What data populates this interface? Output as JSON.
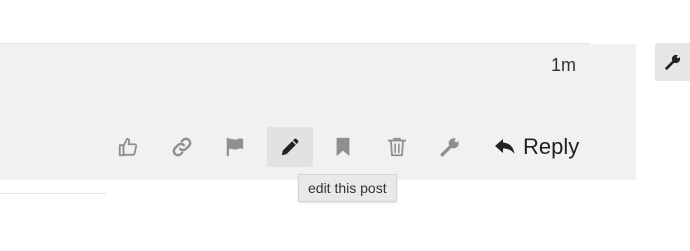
{
  "post": {
    "age": "1m",
    "actions": {
      "like": {
        "icon": "thumbs-up-icon"
      },
      "link": {
        "icon": "link-icon"
      },
      "flag": {
        "icon": "flag-icon"
      },
      "edit": {
        "icon": "pencil-icon",
        "tooltip": "edit this post",
        "active": true
      },
      "bookmark": {
        "icon": "bookmark-icon"
      },
      "delete": {
        "icon": "trash-icon"
      },
      "admin": {
        "icon": "wrench-icon"
      },
      "reply": {
        "icon": "reply-arrow-icon",
        "label": "Reply"
      }
    }
  },
  "sidebar": {
    "admin_button": {
      "icon": "wrench-icon"
    }
  },
  "colors": {
    "icon_muted": "#8f8f8f",
    "icon_dark": "#222222",
    "panel_background": "#f1f1f1",
    "active_button_background": "#e2e2e2"
  }
}
